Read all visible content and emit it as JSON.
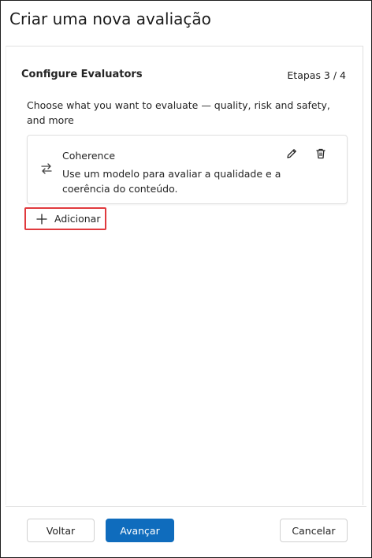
{
  "panel": {
    "title": "Criar uma nova avaliação"
  },
  "section": {
    "title": "Configure Evaluators",
    "steps": "Etapas 3 / 4",
    "description": "Choose what you want to evaluate — quality, risk and safety, and more"
  },
  "evaluators": [
    {
      "name": "Coherence",
      "description": "Use um modelo para avaliar a qualidade e a coerência do conteúdo.",
      "icon": "arrows-swap-icon"
    }
  ],
  "actions": {
    "add_label": "Adicionar"
  },
  "footer": {
    "back_label": "Voltar",
    "next_label": "Avançar",
    "cancel_label": "Cancelar"
  },
  "colors": {
    "primary": "#0f6cbd",
    "highlight": "#e03a3e",
    "border": "#e0e0e0"
  }
}
